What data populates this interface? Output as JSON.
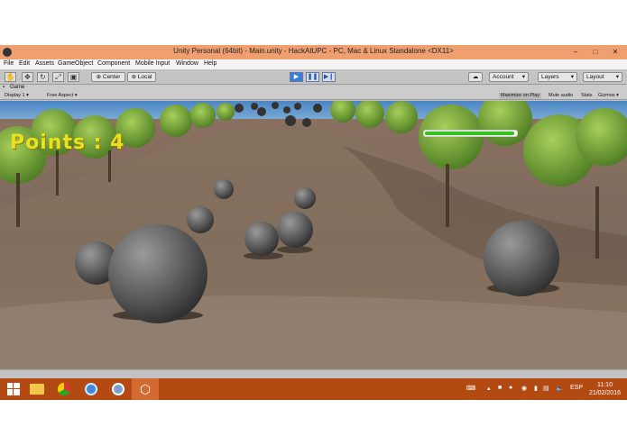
{
  "window": {
    "title": "Unity Personal (64bit) - Main.unity - HackAtUPC - PC, Mac & Linux Standalone <DX11>",
    "minimize": "–",
    "maximize": "□",
    "close": "✕"
  },
  "menu": [
    "File",
    "Edit",
    "Assets",
    "GameObject",
    "Component",
    "Mobile Input",
    "Window",
    "Help"
  ],
  "toolbar": {
    "pivot_label": "Center",
    "space_label": "Local",
    "cloud_icon": "cloud-icon",
    "account_label": "Account",
    "layers_label": "Layers",
    "layout_label": "Layout"
  },
  "game_view": {
    "tab_label": "Game",
    "display_label": "Display 1",
    "aspect_label": "Free Aspect",
    "maximize_label": "Maximize on Play",
    "mute_label": "Mute audio",
    "stats_label": "Stats",
    "gizmos_label": "Gizmos"
  },
  "hud": {
    "points_text": "Points : 4",
    "health_fraction": 0.98,
    "health_color": "#33c21a",
    "points_color": "#e8e020"
  },
  "taskbar": {
    "language": "ESP",
    "time": "11:10",
    "date": "21/02/2016",
    "accent": "#b24a12"
  }
}
